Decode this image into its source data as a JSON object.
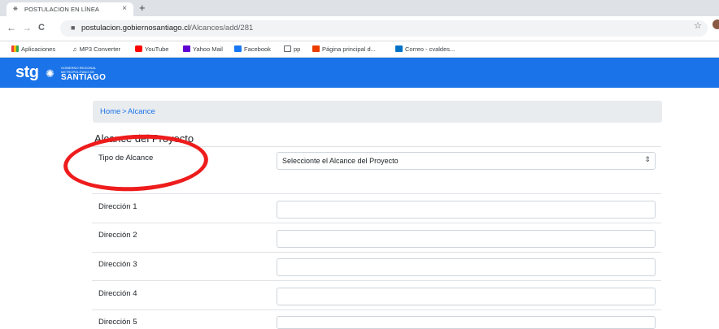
{
  "browser": {
    "tab_title": "POSTULACION EN LÍNEA",
    "tab_close": "×",
    "new_tab": "+",
    "back": "←",
    "forward": "→",
    "reload": "C",
    "url_host": "postulacion.gobiernosantiago.cl",
    "url_path": "/Alcances/add/281",
    "star": "☆"
  },
  "bookmarks": [
    {
      "label": "Aplicaciones",
      "icon": "apps-grid-icon",
      "color": "#e8710a"
    },
    {
      "label": "MP3 Converter",
      "icon": "music-note-icon",
      "color": "#202124"
    },
    {
      "label": "YouTube",
      "icon": "youtube-icon",
      "color": "#ff0000"
    },
    {
      "label": "Yahoo Mail",
      "icon": "yahoo-icon",
      "color": "#5f01d1"
    },
    {
      "label": "Facebook",
      "icon": "facebook-icon",
      "color": "#1877f2"
    },
    {
      "label": "pp",
      "icon": "folder-icon",
      "color": "#5f6368"
    },
    {
      "label": "Página principal d...",
      "icon": "office-icon",
      "color": "#eb3c00"
    },
    {
      "label": "Correo - cvaldes...",
      "icon": "outlook-icon",
      "color": "#0072c6"
    }
  ],
  "header": {
    "logo_main": "stg",
    "logo_small_1": "GOBIERNO REGIONAL",
    "logo_small_2": "METROPOLITANO DE",
    "logo_big": "SANTIAGO",
    "brand_color": "#1a73e8"
  },
  "breadcrumb": {
    "home": "Home",
    "separator": ">",
    "current": "Alcance"
  },
  "form": {
    "section_title": "Alcance del Proyecto",
    "tipo_label": "Tipo de Alcance",
    "tipo_selected": "Seleccionte el Alcance del Proyecto",
    "fields": [
      {
        "label": "Dirección 1",
        "value": ""
      },
      {
        "label": "Dirección 2",
        "value": ""
      },
      {
        "label": "Dirección 3",
        "value": ""
      },
      {
        "label": "Dirección 4",
        "value": ""
      },
      {
        "label": "Dirección 5",
        "value": ""
      }
    ]
  },
  "annotation_color": "#ee1c1c"
}
